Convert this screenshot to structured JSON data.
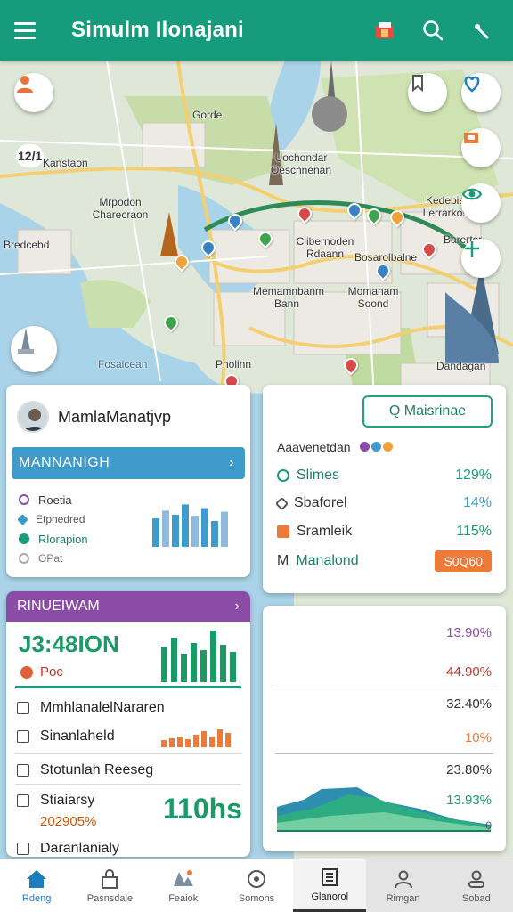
{
  "appbar": {
    "title": "Simulm Ilonajani"
  },
  "map": {
    "labels": [
      "Gorde",
      "12/1",
      "Kanstaon",
      "Mrpodon Charecraon",
      "Uochondar Oeschnenan",
      "Kedebia Lerrarkos",
      "Barertor",
      "Bredcebd",
      "Ciibernoden Rdaann",
      "Bosarolbalne",
      "Memamnbanm Bann",
      "Momanam Soond",
      "Pnolinn",
      "Fosalcean",
      "Dandagan"
    ]
  },
  "card_profile": {
    "name": "MamlaManatjvp",
    "bar_label": "MANNANIGH",
    "items": [
      "Roetia",
      "Etpnedred",
      "Rlorapion",
      "OPat"
    ],
    "bar_values": [
      0.55,
      0.7,
      0.62,
      0.82,
      0.6,
      0.75,
      0.5,
      0.68
    ]
  },
  "card_stats": {
    "button_label": "Q Maisrinae",
    "subtitle": "Aaavenetdan",
    "stats": [
      {
        "label": "Slimes",
        "value": "129%"
      },
      {
        "label": "Sbaforel",
        "value": "14%"
      },
      {
        "label": "Sramleik",
        "value": "115%"
      },
      {
        "label": "Manalond",
        "value": "S0Q60",
        "prefix": "M"
      }
    ]
  },
  "card_purple": {
    "header": "RINUEIWAM",
    "big_value": "J3:48ΙON",
    "doc_label": "Poc",
    "rows": [
      "MmhlanalelNararen",
      "Sinanlaheld",
      "Stotunlah Reeseg",
      "Stiaiarsy",
      "Daranlanialy"
    ],
    "big_number": "110hs",
    "percent": "202905%"
  },
  "card_values": {
    "values": [
      "13.90%",
      "44.90%",
      "32.40%",
      "10%",
      "23.80%",
      "13.93%",
      "0"
    ]
  },
  "bottom_nav": [
    "Rdeng",
    "Pasnsdale",
    "Feaiok",
    "Somons",
    "Glanorol",
    "Rimgan",
    "Sobad"
  ]
}
